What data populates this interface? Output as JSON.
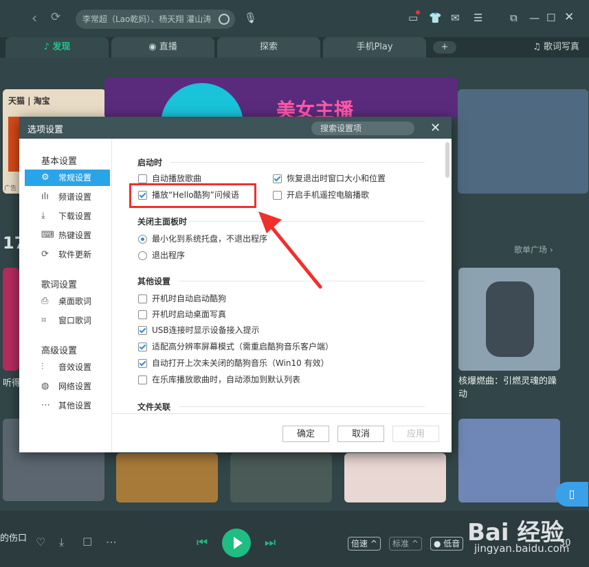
{
  "app": {
    "search_placeholder": "李常超（Lao乾妈）、杨天翔 灌山涛",
    "tabs": [
      "发现",
      "直播",
      "探索",
      "手机Play",
      "+"
    ],
    "lyrics_tab": "歌词写真",
    "side_badge": "17",
    "playlist_square": "歌单广场 ›",
    "banner_text": "美女主播",
    "ad_text": "天猫 | 淘宝",
    "ad_label": "广告",
    "card_left_caption": "听得",
    "card_right_caption": "核爆燃曲：引燃灵魂的躁动",
    "now_playing": "的伤口",
    "speed_label": "倍速 ^",
    "quality_label": "标准 ^",
    "sound_label": "● 低音",
    "volume": "30",
    "colors": {
      "accent": "#1fbd82",
      "selection": "#2aa4e8",
      "highlight": "#f0302c"
    }
  },
  "dialog": {
    "title": "选项设置",
    "search_placeholder": "搜索设置项",
    "close_icon": "close-icon",
    "sidebar": {
      "groups": [
        {
          "label": "基本设置",
          "items": [
            {
              "icon": "gear-icon",
              "glyph": "⚙",
              "label": "常规设置",
              "selected": true
            },
            {
              "icon": "spectrum-icon",
              "glyph": "ılı",
              "label": "频谱设置"
            },
            {
              "icon": "download-icon",
              "glyph": "⤓",
              "label": "下载设置"
            },
            {
              "icon": "keyboard-icon",
              "glyph": "⌨",
              "label": "热键设置"
            },
            {
              "icon": "update-icon",
              "glyph": "⟳",
              "label": "软件更新"
            }
          ]
        },
        {
          "label": "歌词设置",
          "items": [
            {
              "icon": "desktop-lyrics-icon",
              "glyph": "⎙",
              "label": "桌面歌词"
            },
            {
              "icon": "window-lyrics-icon",
              "glyph": "⌗",
              "label": "窗口歌词"
            }
          ]
        },
        {
          "label": "高级设置",
          "items": [
            {
              "icon": "equalizer-icon",
              "glyph": "⫶",
              "label": "音效设置"
            },
            {
              "icon": "network-icon",
              "glyph": "◍",
              "label": "网络设置"
            },
            {
              "icon": "more-icon",
              "glyph": "⋯",
              "label": "其他设置"
            }
          ]
        }
      ]
    },
    "sections": {
      "startup": {
        "title": "启动时",
        "options": [
          {
            "label": "自动播放歌曲",
            "checked": false
          },
          {
            "label": "恢复退出时窗口大小和位置",
            "checked": true
          },
          {
            "label": "播放“Hello酷狗”问候语",
            "checked": true
          },
          {
            "label": "开启手机遥控电脑播歌",
            "checked": false
          }
        ]
      },
      "close_panel": {
        "title": "关闭主面板时",
        "options": [
          {
            "label": "最小化到系统托盘，不退出程序",
            "selected": true
          },
          {
            "label": "退出程序",
            "selected": false
          }
        ]
      },
      "other": {
        "title": "其他设置",
        "options": [
          {
            "label": "开机时自动启动酷狗",
            "checked": false
          },
          {
            "label": "开机时启动桌面写真",
            "checked": false
          },
          {
            "label": "USB连接时显示设备接入提示",
            "checked": true
          },
          {
            "label": "适配高分辨率屏幕模式（需重启酷狗音乐客户端）",
            "checked": true
          },
          {
            "label": "自动打开上次未关闭的酷狗音乐（Win10 有效）",
            "checked": true
          },
          {
            "label": "在乐库播放歌曲时，自动添加到默认列表",
            "checked": false
          }
        ]
      },
      "file_assoc": {
        "title": "文件关联"
      }
    },
    "buttons": {
      "ok": "确定",
      "cancel": "取消",
      "apply": "应用"
    }
  },
  "watermark": {
    "main": "Bai 经验",
    "sub": "jingyan.baidu.com"
  }
}
